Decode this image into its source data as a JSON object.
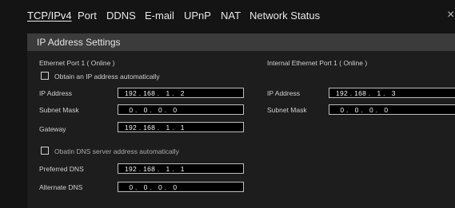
{
  "tabs": [
    {
      "label": "TCP/IPv4",
      "active": true
    },
    {
      "label": "Port",
      "active": false
    },
    {
      "label": "DDNS",
      "active": false
    },
    {
      "label": "E-mail",
      "active": false
    },
    {
      "label": "UPnP",
      "active": false
    },
    {
      "label": "NAT",
      "active": false
    },
    {
      "label": "Network Status",
      "active": false
    }
  ],
  "close_glyph": "×",
  "section_title": "IP Address Settings",
  "ethernet": {
    "heading": "Ethernet Port 1 ( Online )",
    "auto_ip_label": "Obtain an IP address automatically",
    "ip_label": "IP Address",
    "ip_value": "192 . 168 .   1 .   2",
    "subnet_label": "Subnet Mask",
    "subnet_value": "  0 .   0 .   0 .   0",
    "gateway_label": "Gateway",
    "gateway_value": "192 . 168 .   1 .   1"
  },
  "internal": {
    "heading": "Internal Ethernet Port 1 ( Online )",
    "ip_label": "IP Address",
    "ip_value": "192 . 168 .   1 .   3",
    "subnet_label": "Subnet Mask",
    "subnet_value": "  0 .   0 .   0 .   0"
  },
  "dns": {
    "auto_dns_label": "Obatin DNS server address automatically",
    "preferred_label": "Preferred DNS",
    "preferred_value": "192 . 168 .   1 .   1",
    "alternate_label": "Alternate DNS",
    "alternate_value": "  0 .   0 .   0 .   0"
  },
  "colors": {
    "background": "#141414",
    "panel": "#1d1d1d",
    "section_header": "#3b3b3b",
    "field_bg": "#000000",
    "field_border": "#bfbfbf"
  }
}
